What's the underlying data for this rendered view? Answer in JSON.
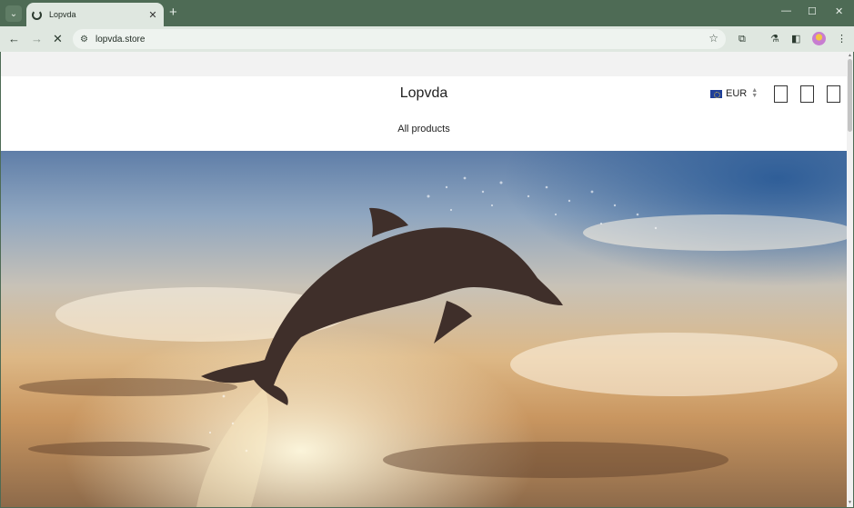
{
  "browser": {
    "tab_title": "Lopvda",
    "url": "lopvda.store",
    "new_tab": "+",
    "tab_close": "✕",
    "tab_search": "⌄",
    "window": {
      "minimize": "—",
      "maximize": "☐",
      "close": "✕"
    }
  },
  "store": {
    "name": "Lopvda",
    "currency": "EUR",
    "nav": {
      "all_products": "All products"
    }
  }
}
